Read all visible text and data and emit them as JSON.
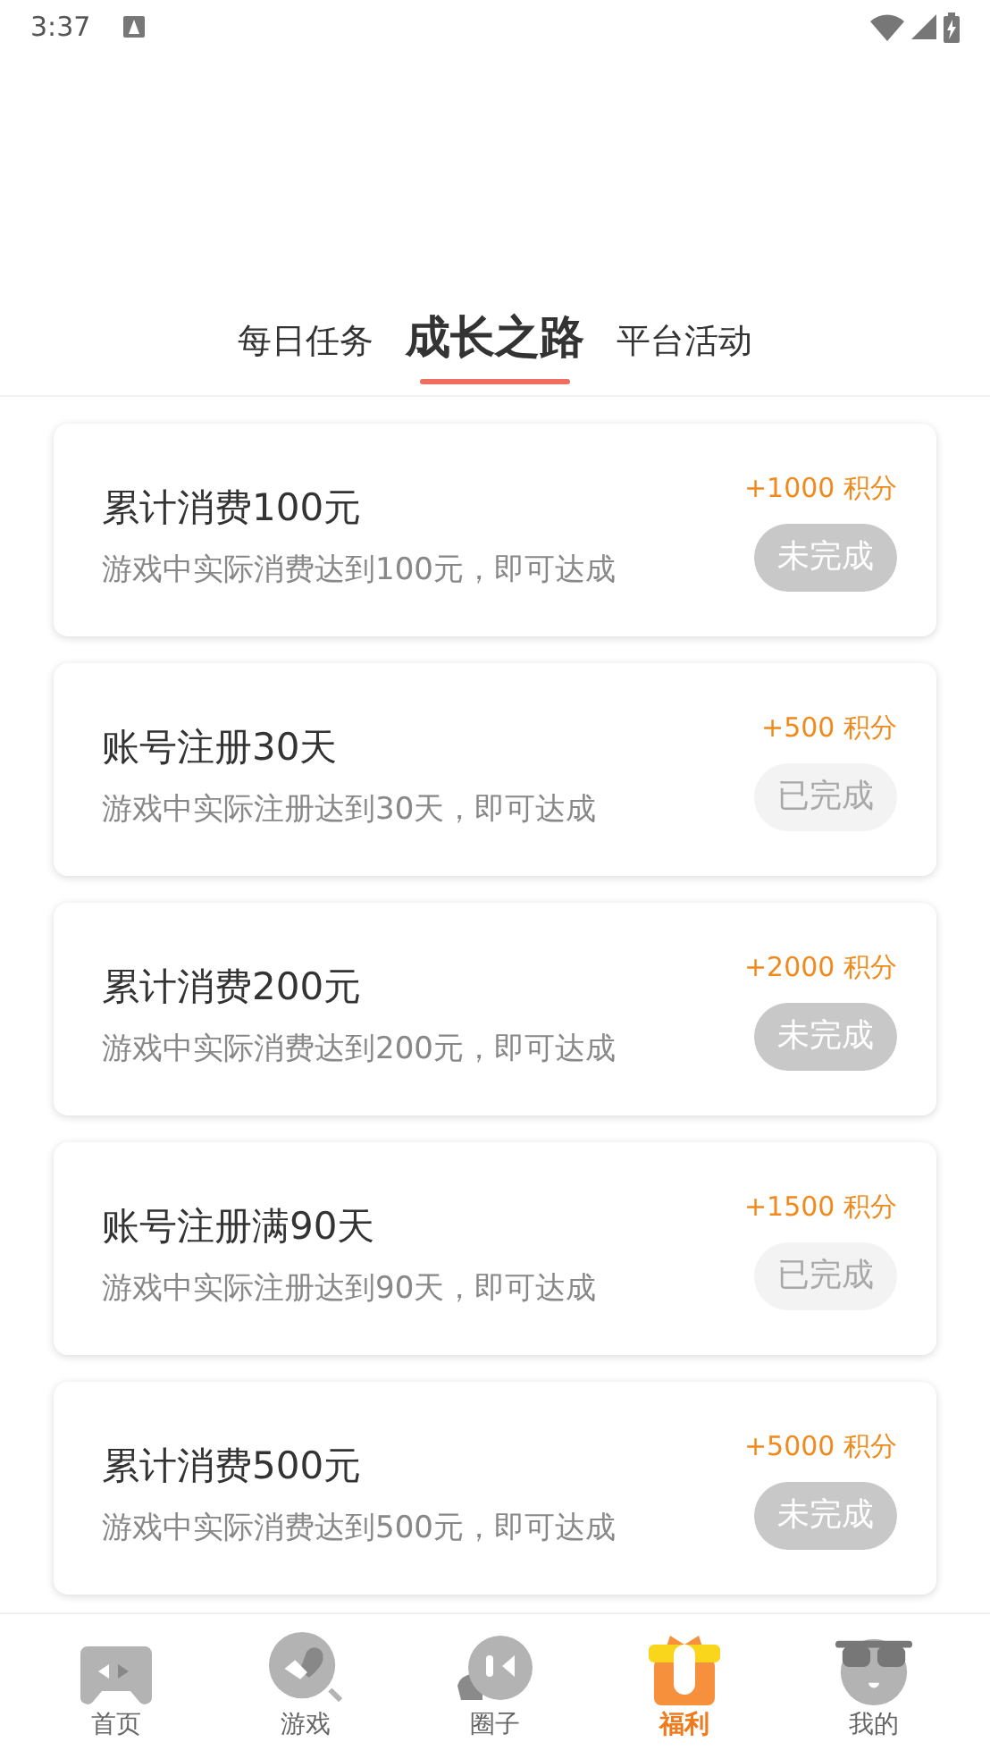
{
  "status_bar": {
    "time": "3:37"
  },
  "tabs": [
    {
      "label": "每日任务",
      "selected": false
    },
    {
      "label": "成长之路",
      "selected": true
    },
    {
      "label": "平台活动",
      "selected": false
    }
  ],
  "tasks": [
    {
      "title": "累计消费100元",
      "description": "游戏中实际消费达到100元，即可达成",
      "points": "+1000 积分",
      "status": "未完成",
      "done": false
    },
    {
      "title": "账号注册30天",
      "description": "游戏中实际注册达到30天，即可达成",
      "points": "+500 积分",
      "status": "已完成",
      "done": true
    },
    {
      "title": "累计消费200元",
      "description": "游戏中实际消费达到200元，即可达成",
      "points": "+2000 积分",
      "status": "未完成",
      "done": false
    },
    {
      "title": "账号注册满90天",
      "description": "游戏中实际注册达到90天，即可达成",
      "points": "+1500 积分",
      "status": "已完成",
      "done": true
    },
    {
      "title": "累计消费500元",
      "description": "游戏中实际消费达到500元，即可达成",
      "points": "+5000 积分",
      "status": "未完成",
      "done": false
    }
  ],
  "bottom_nav": [
    {
      "label": "首页",
      "kind": "gamepad",
      "selected": false
    },
    {
      "label": "游戏",
      "kind": "heart",
      "selected": false
    },
    {
      "label": "圈子",
      "kind": "chat",
      "selected": false
    },
    {
      "label": "福利",
      "kind": "gift",
      "selected": true
    },
    {
      "label": "我的",
      "kind": "face",
      "selected": false
    }
  ]
}
